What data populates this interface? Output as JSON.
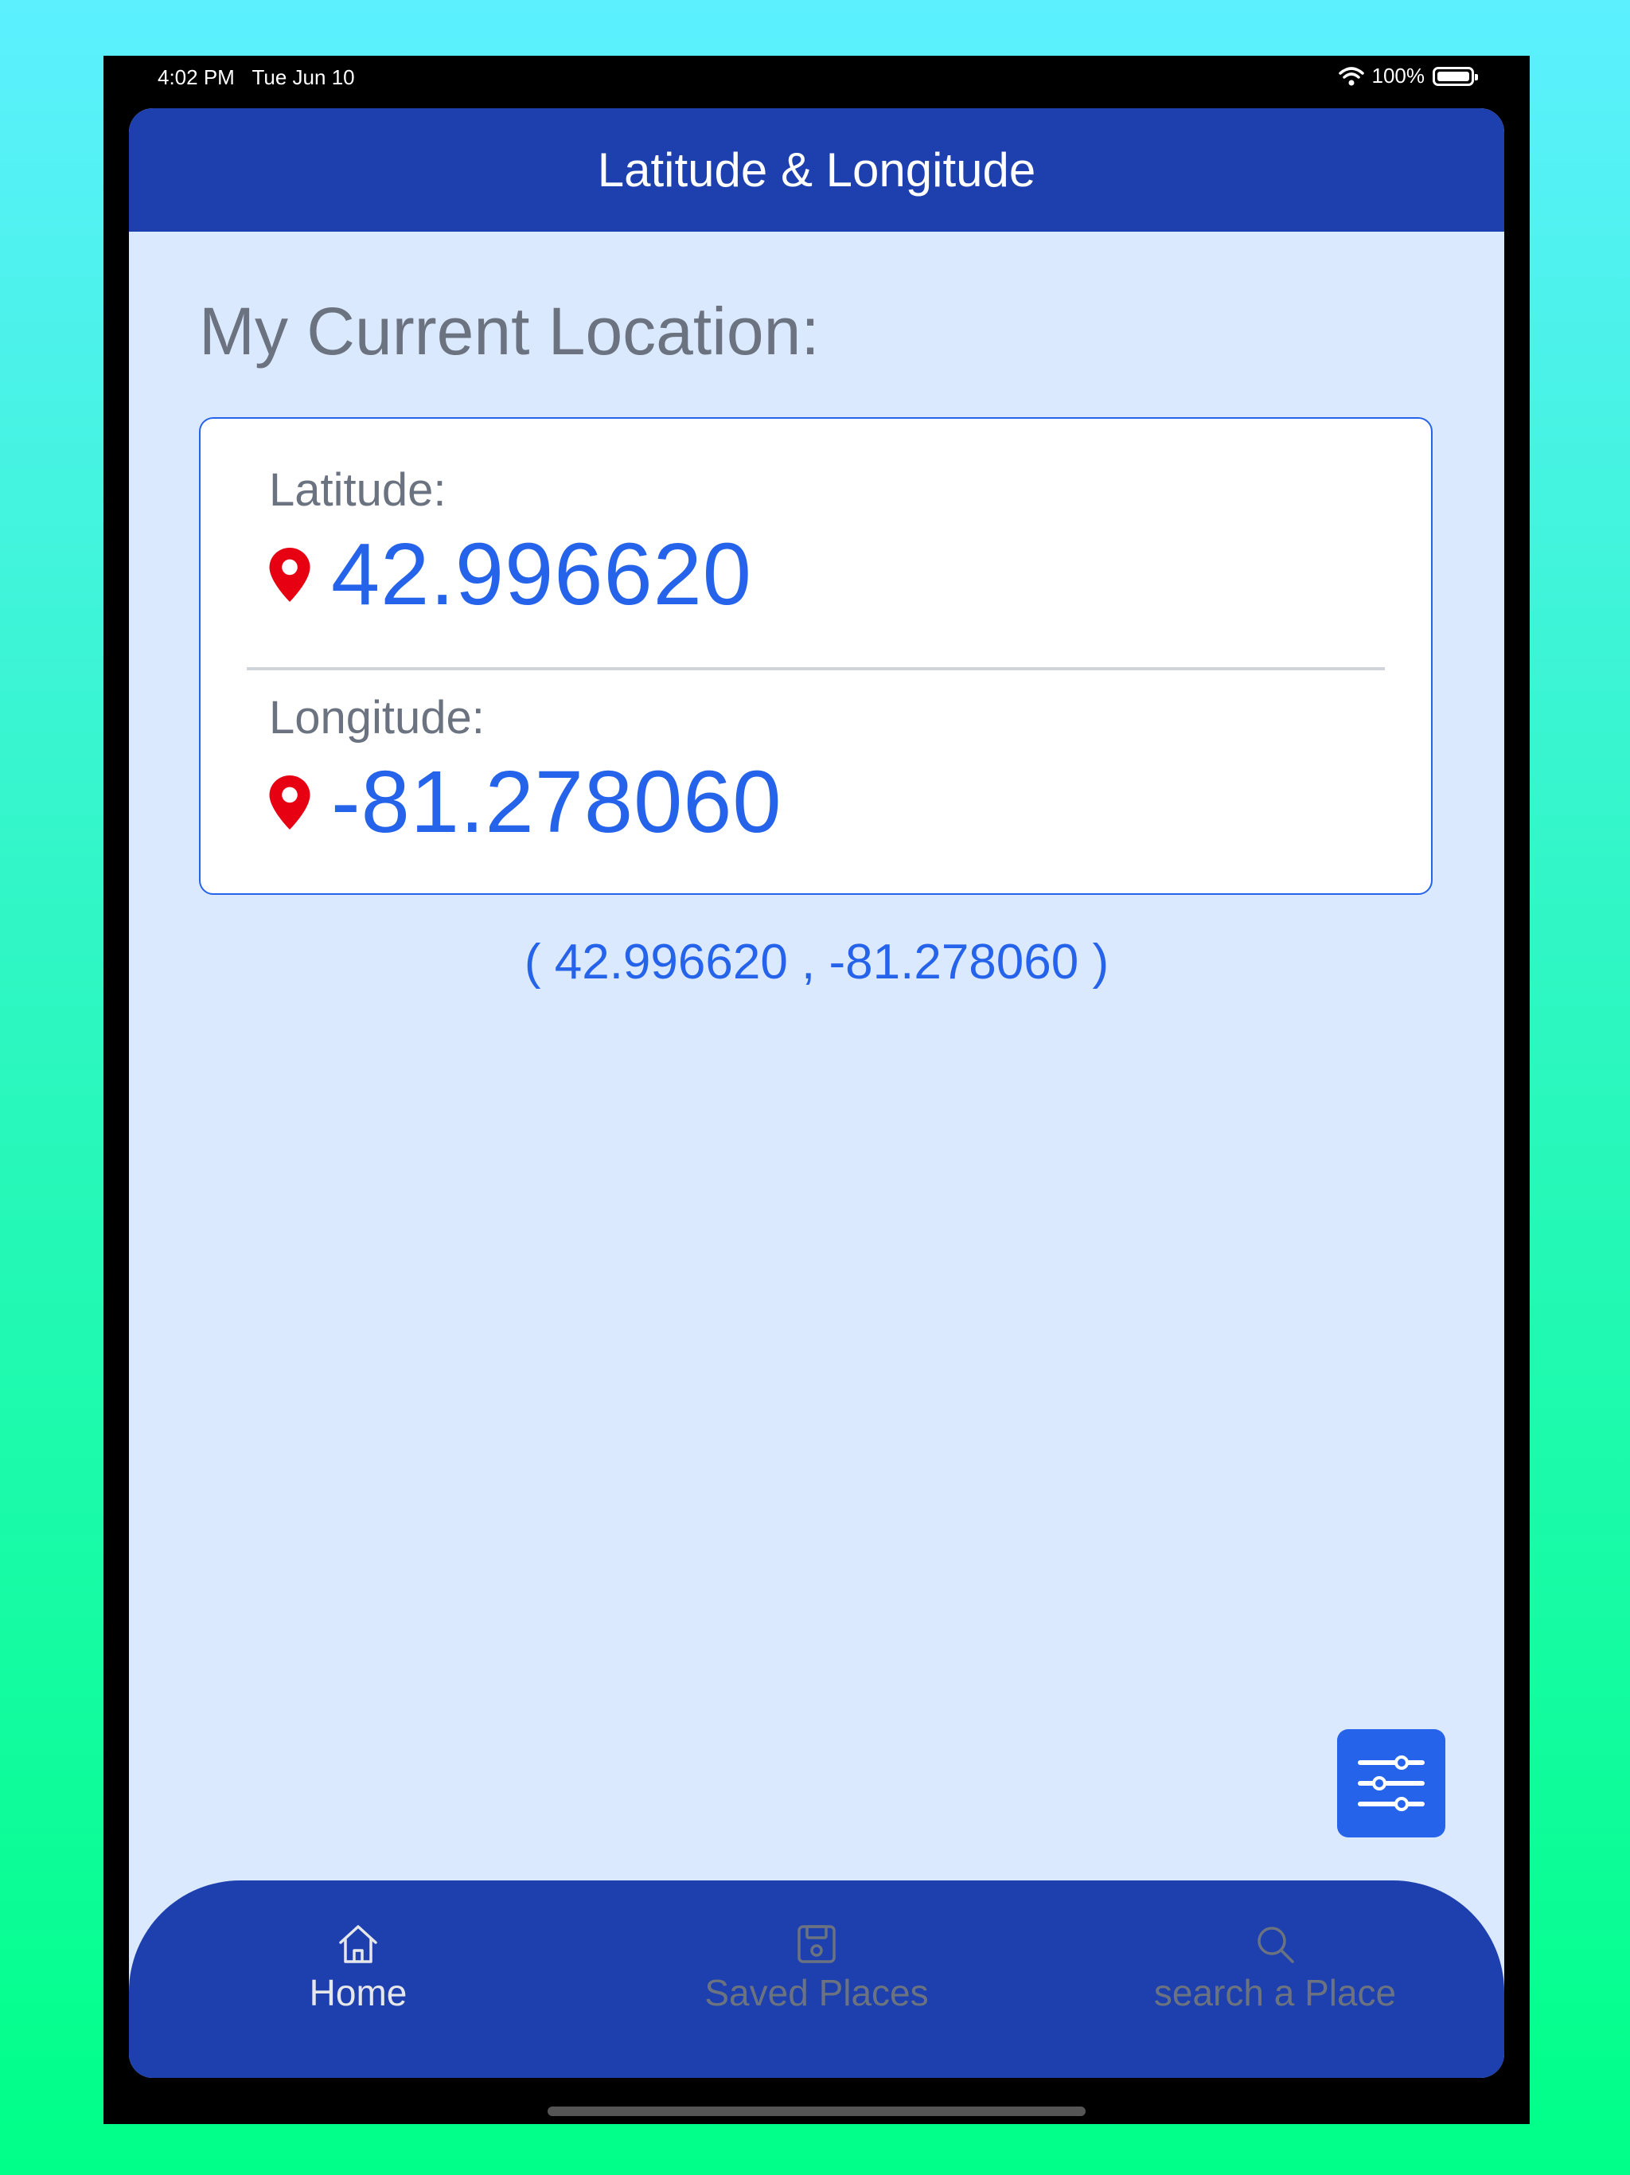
{
  "status_bar": {
    "time": "4:02 PM",
    "date": "Tue Jun 10",
    "battery_percent": "100%",
    "battery_level": 1.0
  },
  "header": {
    "title": "Latitude & Longitude"
  },
  "main": {
    "section_title": "My Current Location:",
    "latitude": {
      "label": "Latitude:",
      "value": "42.996620",
      "icon": "map-pin-icon"
    },
    "longitude": {
      "label": "Longitude:",
      "value": "-81.278060",
      "icon": "map-pin-icon"
    },
    "pair_text": "( 42.996620 , -81.278060 )"
  },
  "settings_button": {
    "icon": "sliders-icon"
  },
  "tabs": [
    {
      "label": "Home",
      "icon": "home-icon",
      "active": true
    },
    {
      "label": "Saved Places",
      "icon": "save-icon",
      "active": false
    },
    {
      "label": "search a Place",
      "icon": "search-icon",
      "active": false
    }
  ],
  "colors": {
    "header_bg": "#1e40af",
    "screen_bg": "#dbe9fe",
    "accent": "#2563eb",
    "pin": "#e60012",
    "muted_text": "#6b7280"
  }
}
